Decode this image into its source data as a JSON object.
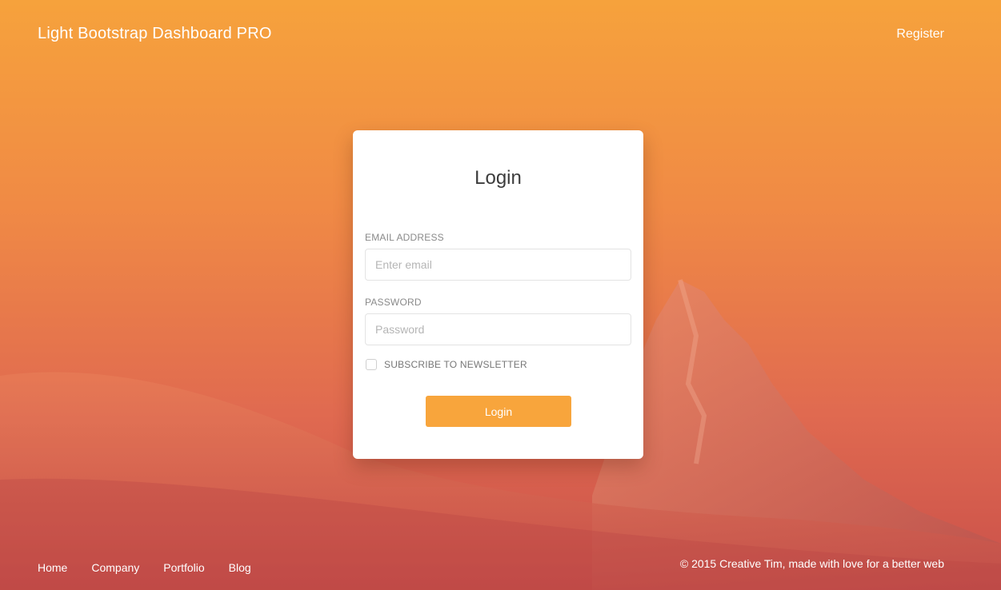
{
  "navbar": {
    "brand": "Light Bootstrap Dashboard PRO",
    "register_label": "Register"
  },
  "login_card": {
    "title": "Login",
    "email": {
      "label": "Email Address",
      "placeholder": "Enter email",
      "value": ""
    },
    "password": {
      "label": "Password",
      "placeholder": "Password",
      "value": ""
    },
    "newsletter": {
      "label": "Subscribe to newsletter",
      "checked": false
    },
    "submit_label": "Login"
  },
  "footer": {
    "links": [
      "Home",
      "Company",
      "Portfolio",
      "Blog"
    ],
    "copyright": "© 2015 Creative Tim, made with love for a better web"
  },
  "colors": {
    "accent": "#f8a53c",
    "background_top": "#f6a23c",
    "background_bottom": "#c94f4a"
  }
}
